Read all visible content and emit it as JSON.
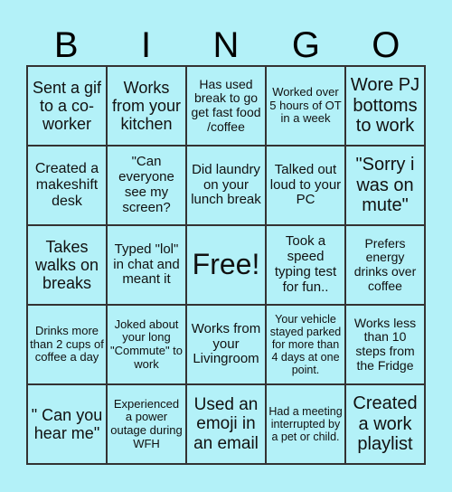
{
  "header": {
    "letters": [
      "B",
      "I",
      "N",
      "G",
      "O"
    ]
  },
  "board": {
    "background_color": "#b3f1f8",
    "cells": [
      [
        "Sent a gif to a co-worker",
        "Works from your kitchen",
        "Has used break to go get fast food /coffee",
        "Worked over 5 hours of OT in a week",
        "Wore PJ bottoms to work"
      ],
      [
        "Created a makeshift desk",
        "\"Can everyone see my screen?",
        "Did laundry on your lunch break",
        "Talked out loud to your PC",
        "\"Sorry i was on mute\""
      ],
      [
        "Takes walks on breaks",
        "Typed \"lol\" in chat and meant it",
        "Free!",
        "Took a speed typing test for fun..",
        "Prefers energy drinks over coffee"
      ],
      [
        "Drinks more than 2 cups of coffee a day",
        "Joked about your long \"Commute\" to work",
        "Works from your Livingroom",
        "Your vehicle stayed parked for more than 4 days at one point.",
        "Works less than 10 steps from the Fridge"
      ],
      [
        "\" Can you hear me\"",
        "Experienced a power outage during WFH",
        "Used an emoji in an email",
        "Had a meeting interrupted by a pet or child.",
        "Created a work playlist"
      ]
    ]
  }
}
